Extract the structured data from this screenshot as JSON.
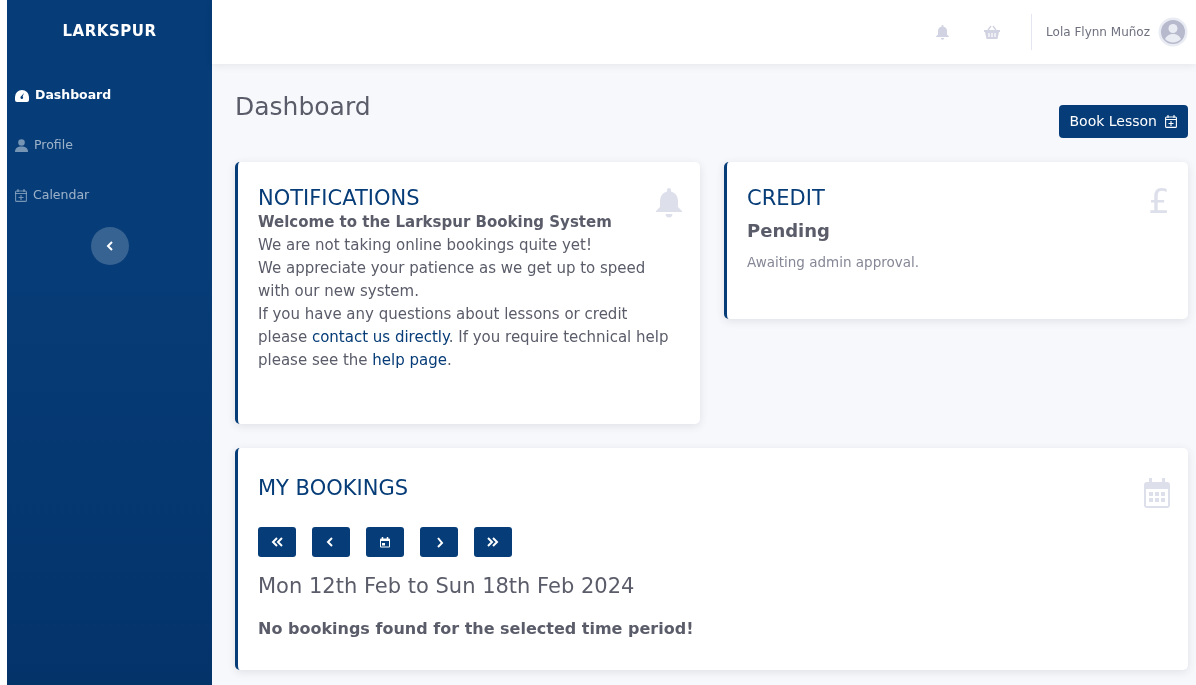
{
  "sidebar": {
    "brand": "LARKSPUR",
    "items": [
      {
        "label": "Dashboard",
        "selected": true
      },
      {
        "label": "Profile",
        "selected": false
      },
      {
        "label": "Calendar",
        "selected": false
      }
    ]
  },
  "topbar": {
    "user": "Lola Flynn Muñoz"
  },
  "page": {
    "title": "Dashboard",
    "action": "Book Lesson"
  },
  "notifications": {
    "title": "NOTIFICATIONS",
    "heading": "Welcome to the Larkspur Booking System",
    "lines": [
      "We are not taking online bookings quite yet!",
      "We appreciate your patience as we get up to speed with our new system."
    ],
    "paragraph": [
      {
        "kind": "text",
        "text": "If you have any questions about lessons or credit please "
      },
      {
        "kind": "link",
        "text": "contact us directly"
      },
      {
        "kind": "text",
        "text": ". If you require technical help please see the "
      },
      {
        "kind": "link",
        "text": "help page"
      },
      {
        "kind": "text",
        "text": "."
      }
    ]
  },
  "credit": {
    "title": "CREDIT",
    "symbol": "£",
    "status": "Pending",
    "note": "Awaiting admin approval."
  },
  "bookings": {
    "title": "MY BOOKINGS",
    "range": "Mon 12th Feb to Sun 18th Feb 2024",
    "empty": "No bookings found for the selected time period!"
  }
}
